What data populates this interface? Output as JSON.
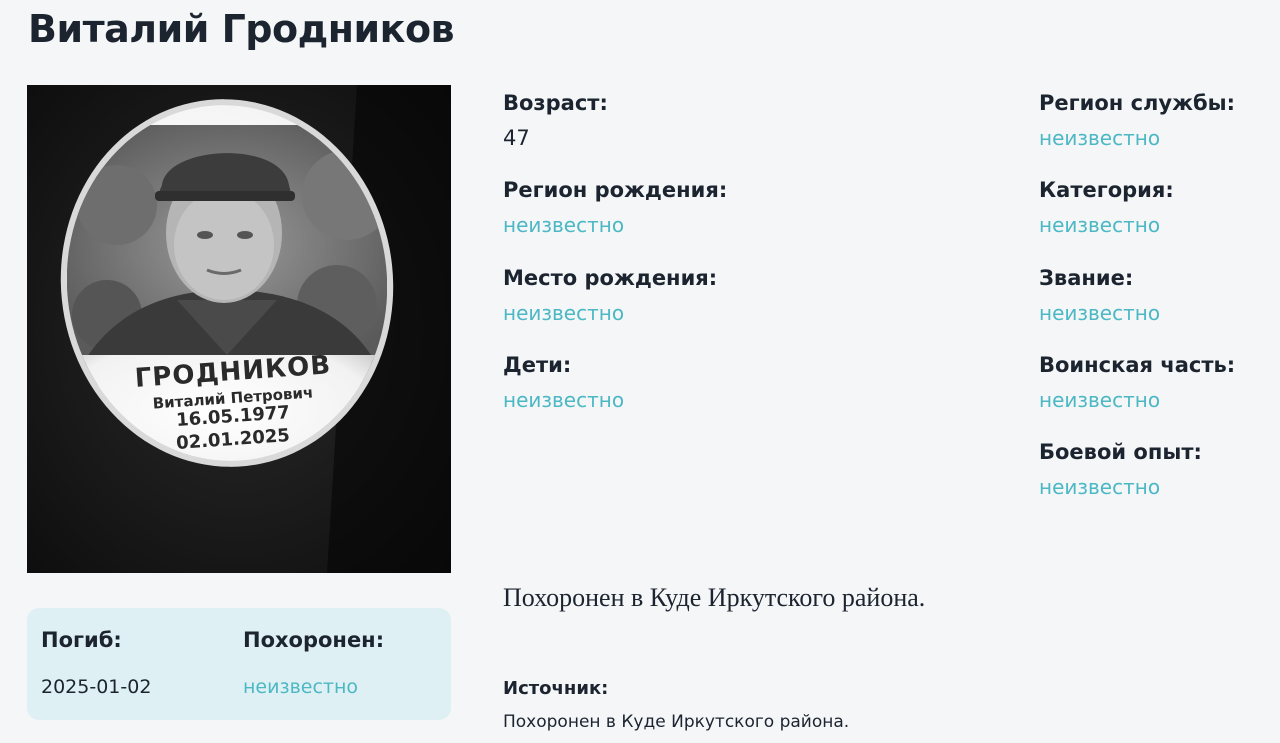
{
  "person": {
    "name": "Виталий Гродников"
  },
  "photo": {
    "plaque_surname": "ГРОДНИКОВ",
    "plaque_name": "Виталий Петрович",
    "plaque_born": "16.05.1977",
    "plaque_died": "02.01.2025"
  },
  "death": {
    "died_label": "Погиб:",
    "died_value": "2025-01-02",
    "buried_label": "Похоронен:",
    "buried_value": "неизвестно"
  },
  "fields_left": [
    {
      "label": "Возраст:",
      "value": "47"
    },
    {
      "label": "Регион рождения:",
      "value": "неизвестно"
    },
    {
      "label": "Место рождения:",
      "value": "неизвестно"
    },
    {
      "label": "Дети:",
      "value": "неизвестно"
    }
  ],
  "fields_right": [
    {
      "label": "Регион службы:",
      "value": "неизвестно"
    },
    {
      "label": "Категория:",
      "value": "неизвестно"
    },
    {
      "label": "Звание:",
      "value": "неизвестно"
    },
    {
      "label": "Воинская часть:",
      "value": "неизвестно"
    },
    {
      "label": "Боевой опыт:",
      "value": "неизвестно"
    }
  ],
  "burial_note": "Похоронен в Куде Иркутского района.",
  "source": {
    "label": "Источник:",
    "value": "Похоронен в Куде Иркутского района."
  },
  "colors": {
    "background": "#f4f6f8",
    "text": "#1c2430",
    "accent_link": "#4cb8c4",
    "death_box_bg": "#dff0f4"
  }
}
